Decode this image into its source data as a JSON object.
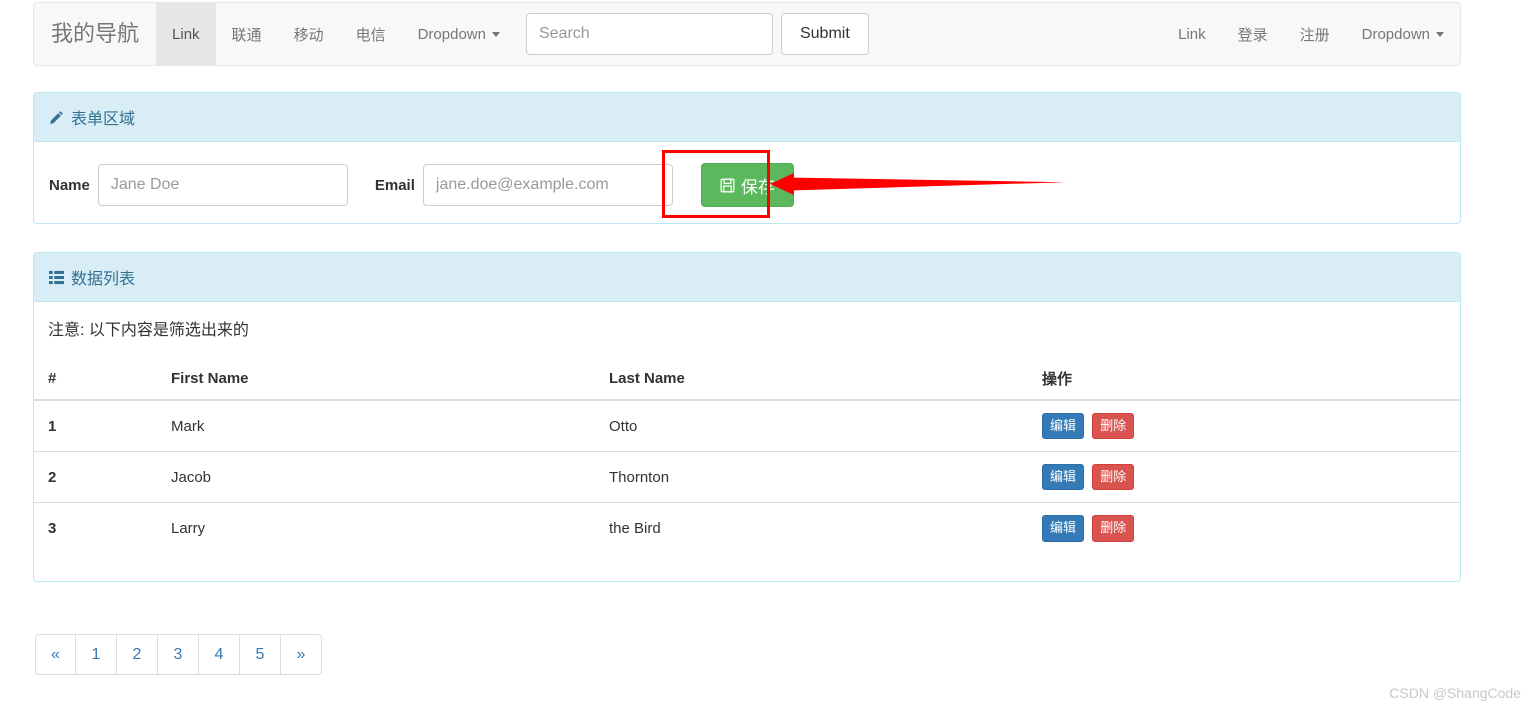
{
  "navbar": {
    "brand": "我的导航",
    "left_items": [
      {
        "label": "Link",
        "active": true,
        "caret": false
      },
      {
        "label": "联通",
        "active": false,
        "caret": false
      },
      {
        "label": "移动",
        "active": false,
        "caret": false
      },
      {
        "label": "电信",
        "active": false,
        "caret": false
      },
      {
        "label": "Dropdown",
        "active": false,
        "caret": true
      }
    ],
    "search": {
      "value": "",
      "placeholder": "Search"
    },
    "submit_label": "Submit",
    "right_items": [
      {
        "label": "Link",
        "caret": false
      },
      {
        "label": "登录",
        "caret": false
      },
      {
        "label": "注册",
        "caret": false
      },
      {
        "label": "Dropdown",
        "caret": true
      }
    ]
  },
  "form_panel": {
    "icon": "pencil-icon",
    "title": "表单区域",
    "name_label": "Name",
    "name_value": "",
    "name_placeholder": "Jane Doe",
    "email_label": "Email",
    "email_value": "",
    "email_placeholder": "jane.doe@example.com",
    "save_icon": "save-floppy-icon",
    "save_label": "保存"
  },
  "data_panel": {
    "icon": "th-list-icon",
    "title": "数据列表",
    "note": "注意: 以下内容是筛选出来的",
    "columns": [
      "#",
      "First Name",
      "Last Name",
      "操作"
    ],
    "rows": [
      {
        "num": "1",
        "first": "Mark",
        "last": "Otto",
        "edit": "编辑",
        "delete": "删除"
      },
      {
        "num": "2",
        "first": "Jacob",
        "last": "Thornton",
        "edit": "编辑",
        "delete": "删除"
      },
      {
        "num": "3",
        "first": "Larry",
        "last": "the Bird",
        "edit": "编辑",
        "delete": "删除"
      }
    ]
  },
  "pagination": [
    "«",
    "1",
    "2",
    "3",
    "4",
    "5",
    "»"
  ],
  "annotation": {
    "highlight_color": "#ff0000",
    "target": "save-button"
  },
  "watermark": "CSDN @ShangCode",
  "colors": {
    "panel_header_bg": "#d9edf7",
    "panel_border": "#bce8f1",
    "panel_header_text": "#31708f",
    "navbar_bg": "#f8f8f8",
    "save_green": "#5cb85c",
    "edit_blue": "#337ab7",
    "delete_red": "#d9534f",
    "link_blue": "#337ab7"
  }
}
